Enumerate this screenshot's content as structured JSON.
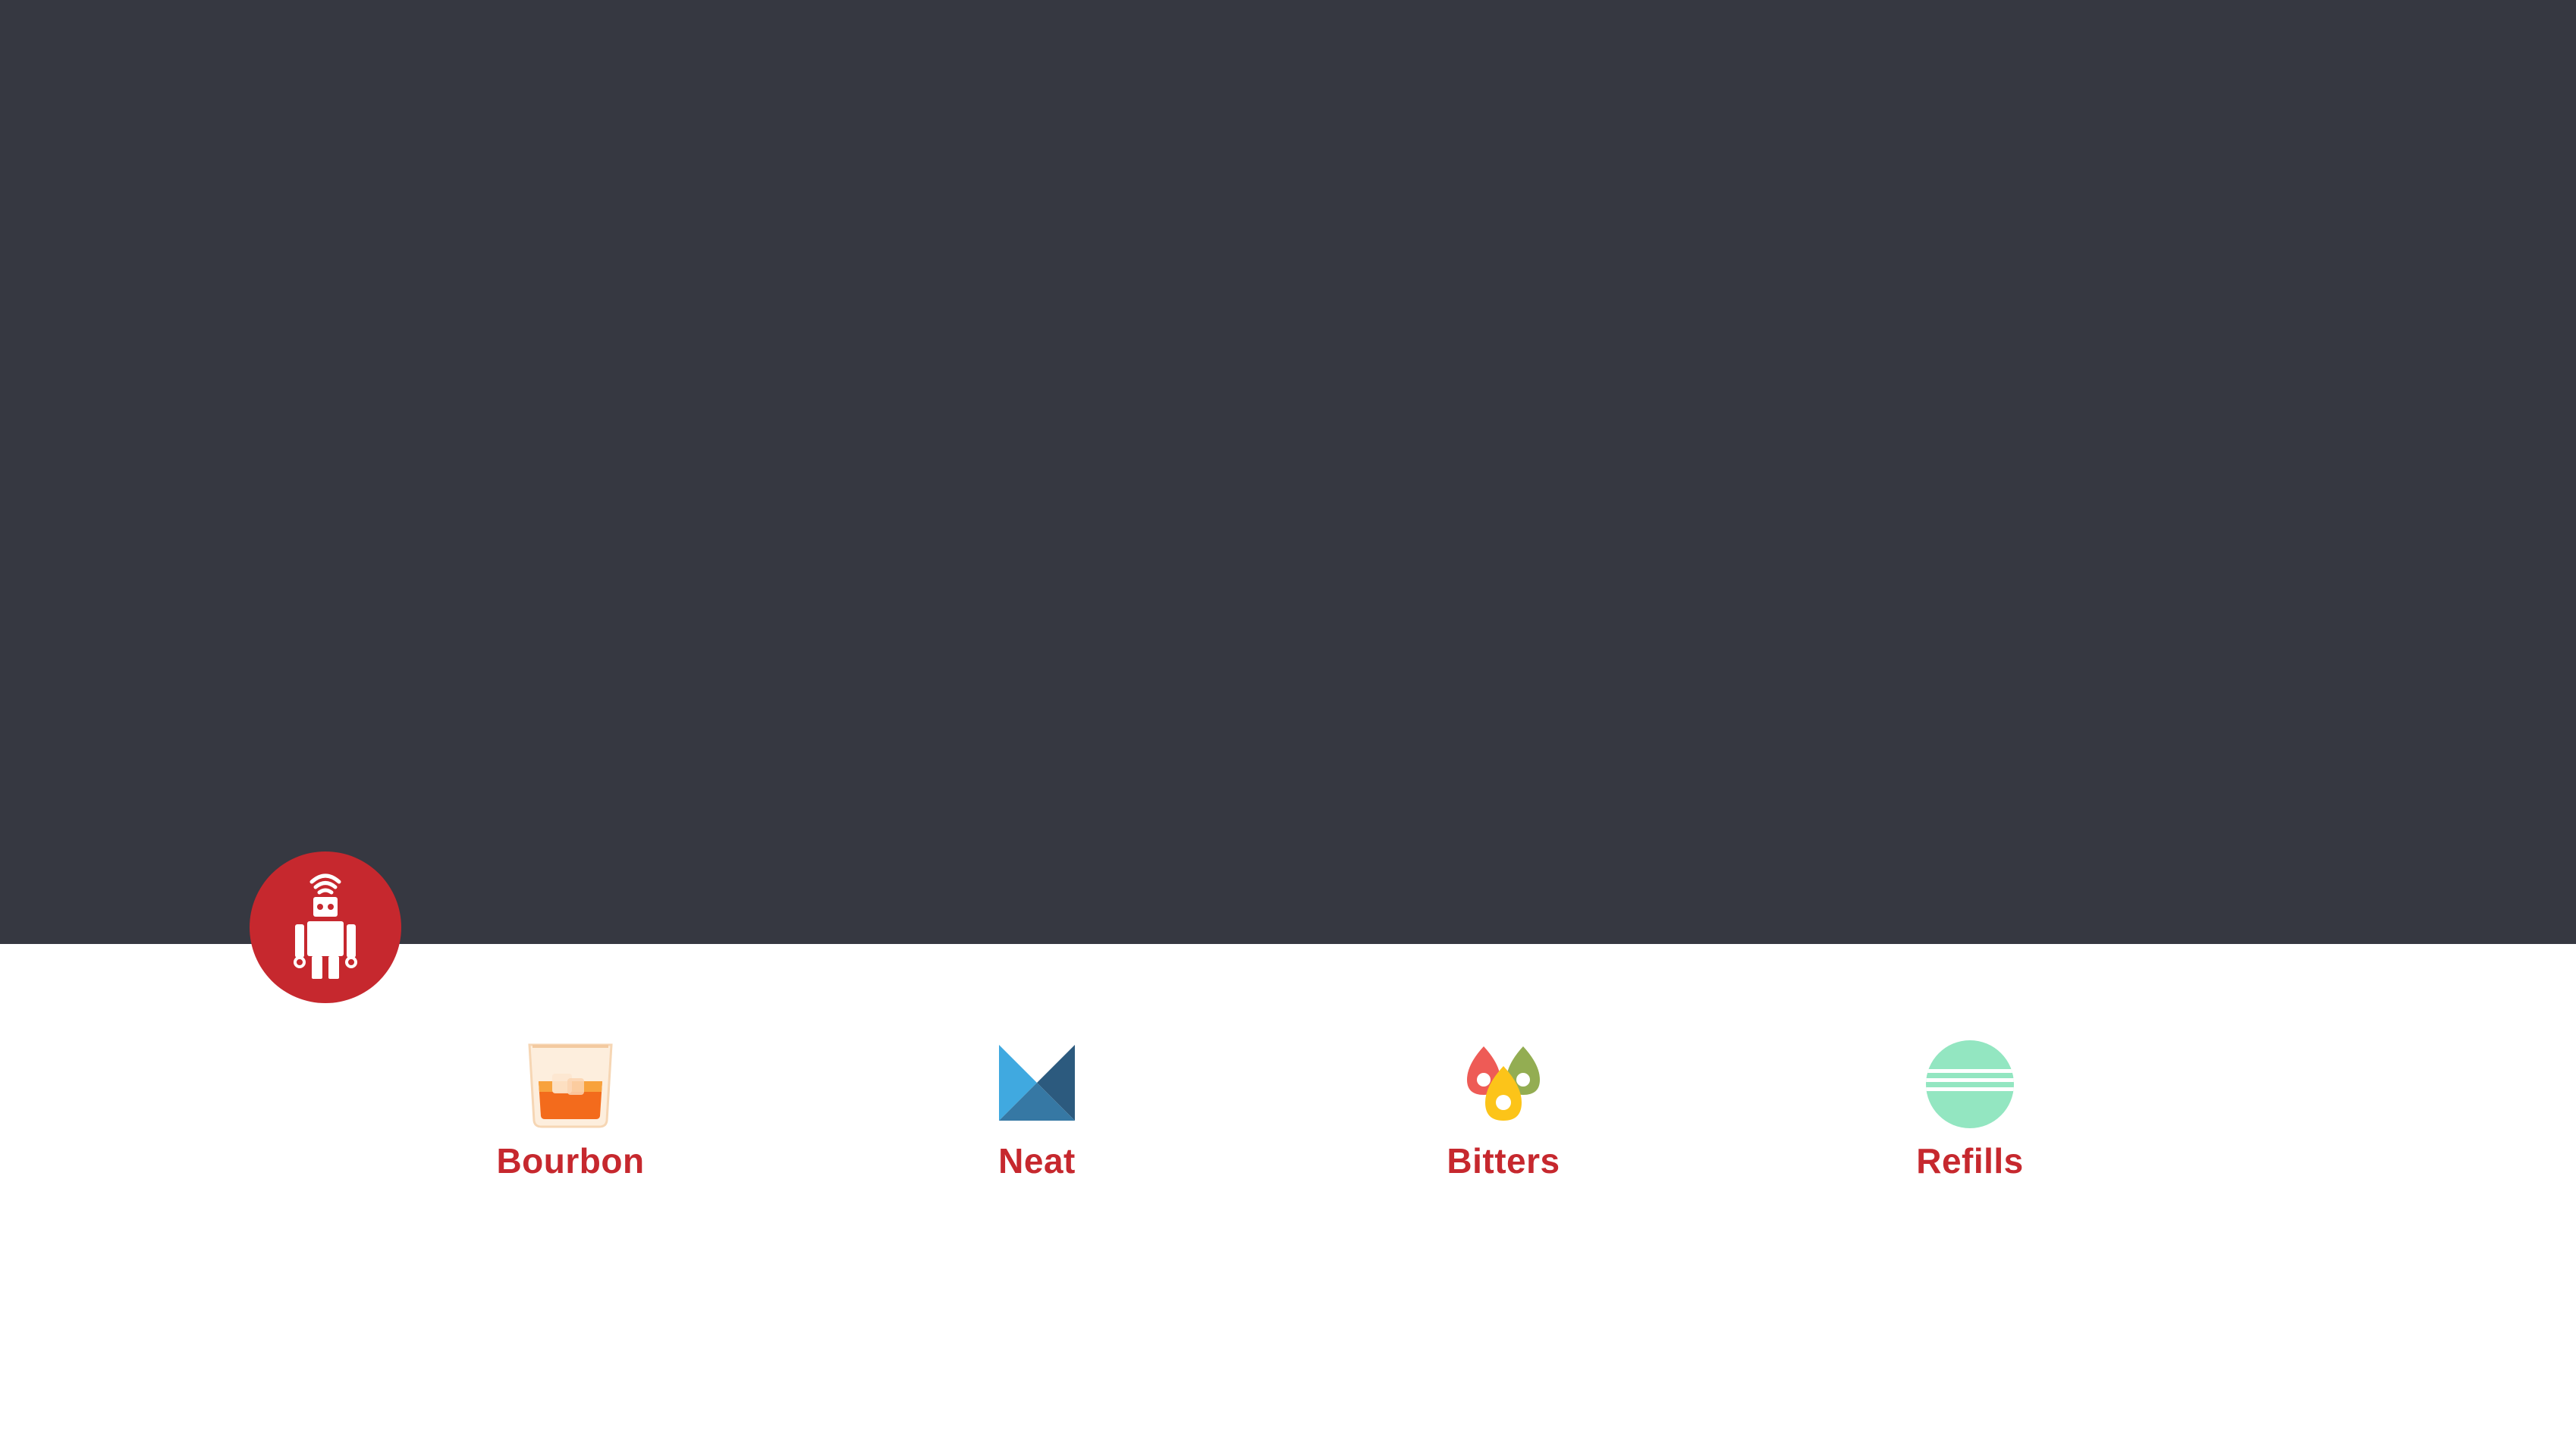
{
  "colors": {
    "hero_background": "#363841",
    "page_background": "#ffffff",
    "brand_red": "#c6282e",
    "label_color": "#c6282e"
  },
  "badge": {
    "icon": "robot-icon"
  },
  "apps": [
    {
      "label": "Bourbon",
      "icon": "whiskey-glass-icon"
    },
    {
      "label": "Neat",
      "icon": "neat-logo-icon"
    },
    {
      "label": "Bitters",
      "icon": "bitters-drops-icon"
    },
    {
      "label": "Refills",
      "icon": "refills-circle-icon"
    }
  ]
}
